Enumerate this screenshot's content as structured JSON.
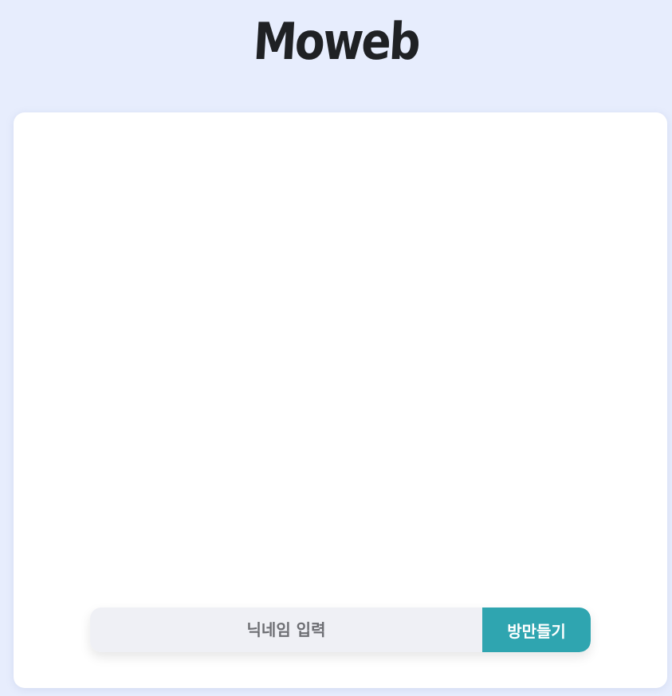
{
  "header": {
    "logo_text": "Moweb"
  },
  "join": {
    "nickname_placeholder": "닉네임 입력",
    "nickname_value": "",
    "create_room_label": "방만들기"
  },
  "colors": {
    "background": "#e7edfd",
    "card": "#ffffff",
    "input_bg": "#eff0f5",
    "accent": "#2fa5b0",
    "logo": "#1f2124"
  }
}
